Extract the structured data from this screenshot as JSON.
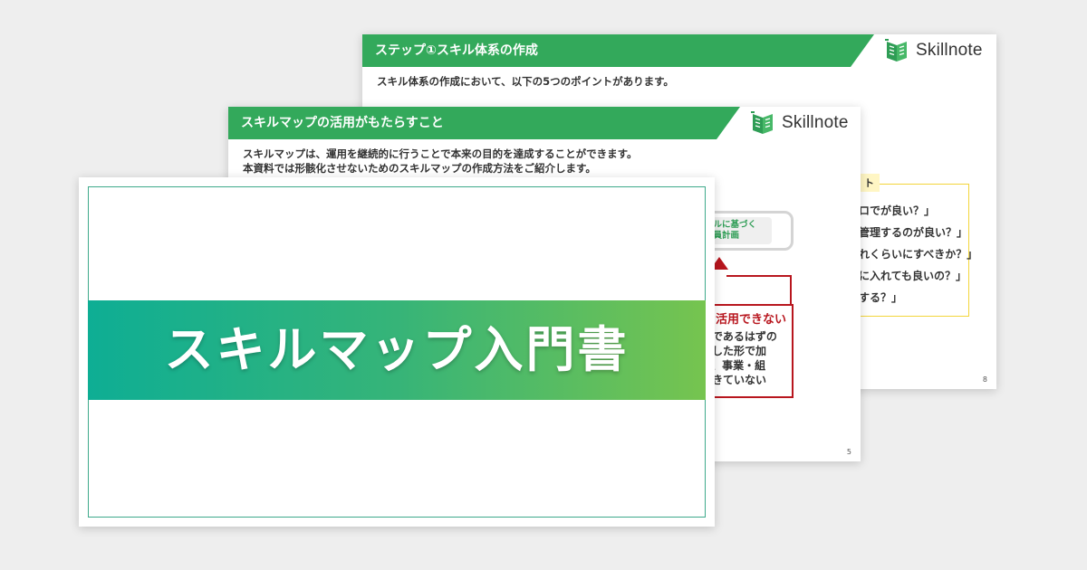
{
  "slides": {
    "back": {
      "header_title": "ステップ①スキル体系の作成",
      "logo": "Skillnote",
      "intro": "スキル体系の作成において、以下の5つのポイントがあります。",
      "box_tag": "ト",
      "lines": [
        "ロでが良い？」",
        "管理するのが良い？」",
        "れくらいにすべきか？」",
        "に入れても良いの？」",
        "する？」"
      ],
      "page_number": "8"
    },
    "middle": {
      "header_title": "スキルマップの活用がもたらすこと",
      "logo": "Skillnote",
      "intro_1": "スキルマップは、運用を継続的に行うことで本来の目的を達成することができます。",
      "intro_2": "本資料では形骸化させないためのスキルマップの作成方法をご紹介します。",
      "pill_line_1": "キルに基づく",
      "pill_line_2": "要員計画",
      "red_title": "活用できない",
      "red_lines": [
        "益であるはずの",
        "適した形で加",
        "ず、事業・組",
        "できていない"
      ],
      "page_number": "5"
    },
    "front": {
      "title": "スキルマップ入門書"
    }
  },
  "colors": {
    "brand_green": "#33a95b",
    "alert_red": "#b8161e",
    "highlight_yellow": "#f3d53a"
  },
  "icons": {
    "logo": "skillnote-logo-icon"
  }
}
